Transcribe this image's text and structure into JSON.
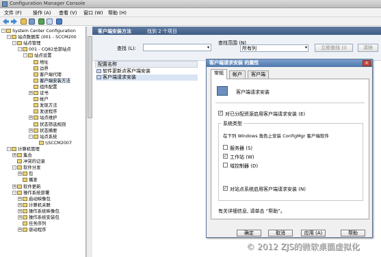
{
  "window": {
    "title": "Configuration Manager Console"
  },
  "menu": [
    "文件 (F)",
    "操作 (A)",
    "查看 (V)",
    "窗口 (W)",
    "帮助 (H)"
  ],
  "tree": [
    {
      "label": "System Center Configuration",
      "level": 0,
      "exp": "-"
    },
    {
      "label": "站点数据库 (001 - SCCM200",
      "level": 1,
      "exp": "-"
    },
    {
      "label": "站点管理",
      "level": 2,
      "exp": "-"
    },
    {
      "label": "001 - CQ82总部站点",
      "level": 3,
      "exp": "-"
    },
    {
      "label": "站点设置",
      "level": 4,
      "exp": "-"
    },
    {
      "label": "地址",
      "level": 5,
      "exp": ""
    },
    {
      "label": "边界",
      "level": 5,
      "exp": ""
    },
    {
      "label": "客户端代理",
      "level": 5,
      "exp": ""
    },
    {
      "label": "客户端安装方法",
      "level": 5,
      "exp": "",
      "selected": true
    },
    {
      "label": "组件配置",
      "level": 5,
      "exp": ""
    },
    {
      "label": "证书",
      "level": 5,
      "exp": "+"
    },
    {
      "label": "帐户",
      "level": 5,
      "exp": ""
    },
    {
      "label": "发现方法",
      "level": 5,
      "exp": ""
    },
    {
      "label": "发送程序",
      "level": 5,
      "exp": ""
    },
    {
      "label": "站点维护",
      "level": 5,
      "exp": "+"
    },
    {
      "label": "状态筛选规则",
      "level": 5,
      "exp": ""
    },
    {
      "label": "状态摘要",
      "level": 5,
      "exp": "+"
    },
    {
      "label": "站点系统",
      "level": 5,
      "exp": "-"
    },
    {
      "label": "\\\\SCCM2007",
      "level": 6,
      "exp": ""
    },
    {
      "label": "计算机管理",
      "level": 1,
      "exp": "-"
    },
    {
      "label": "集合",
      "level": 2,
      "exp": "+"
    },
    {
      "label": "冲突的记录",
      "level": 2,
      "exp": ""
    },
    {
      "label": "软件分发",
      "level": 2,
      "exp": "-"
    },
    {
      "label": "包",
      "level": 3,
      "exp": "+"
    },
    {
      "label": "播发",
      "level": 3,
      "exp": ""
    },
    {
      "label": "软件更新",
      "level": 2,
      "exp": "+"
    },
    {
      "label": "操作系统部署",
      "level": 2,
      "exp": "-"
    },
    {
      "label": "启动映像包",
      "level": 3,
      "exp": "+"
    },
    {
      "label": "计算机关联",
      "level": 3,
      "exp": "+"
    },
    {
      "label": "操作系统映像包",
      "level": 3,
      "exp": "+"
    },
    {
      "label": "操作系统安装包",
      "level": 3,
      "exp": "+"
    },
    {
      "label": "任务序列",
      "level": 3,
      "exp": ""
    },
    {
      "label": "驱动程序",
      "level": 3,
      "exp": "+"
    }
  ],
  "content": {
    "header_title": "客户端安装方法",
    "header_count": "找到 2 个项目",
    "search_label": "查找 (L):",
    "search_value": "",
    "scope_label": "查找范围 (N)",
    "scope_value": "所有列",
    "find_now": "立即查找 (I)",
    "clear": "清除",
    "column_header": "配置名称",
    "items": [
      {
        "label": "软件更新点客户端安装"
      },
      {
        "label": "客户端请求安装",
        "selected": true
      }
    ]
  },
  "dialog": {
    "title": "客户端请求安装 的属性",
    "tabs": [
      "常规",
      "帐户",
      "客户端"
    ],
    "active_tab": 0,
    "heading": "客户端请求安装",
    "enable_label": "对已分配资源启用客户端请求安装 (E)",
    "enable_checked": true,
    "group_title": "系统类型",
    "group_desc": "在下列 Windows 角色上安装 ConfigMgr 客户端软件",
    "options": [
      {
        "label": "服务器 (S)",
        "checked": false
      },
      {
        "label": "工作站 (W)",
        "checked": true
      },
      {
        "label": "域控制器 (D)",
        "checked": false
      }
    ],
    "site_label": "对站点系统启用客户端请求安装 (N)",
    "site_checked": true,
    "help_text": "有关详细信息, 请单击 “帮助”。",
    "buttons": [
      "确定",
      "取消",
      "应用 (A)",
      "帮助"
    ]
  },
  "watermark": "© 2012 ZJS的微软桌面虚拟化"
}
